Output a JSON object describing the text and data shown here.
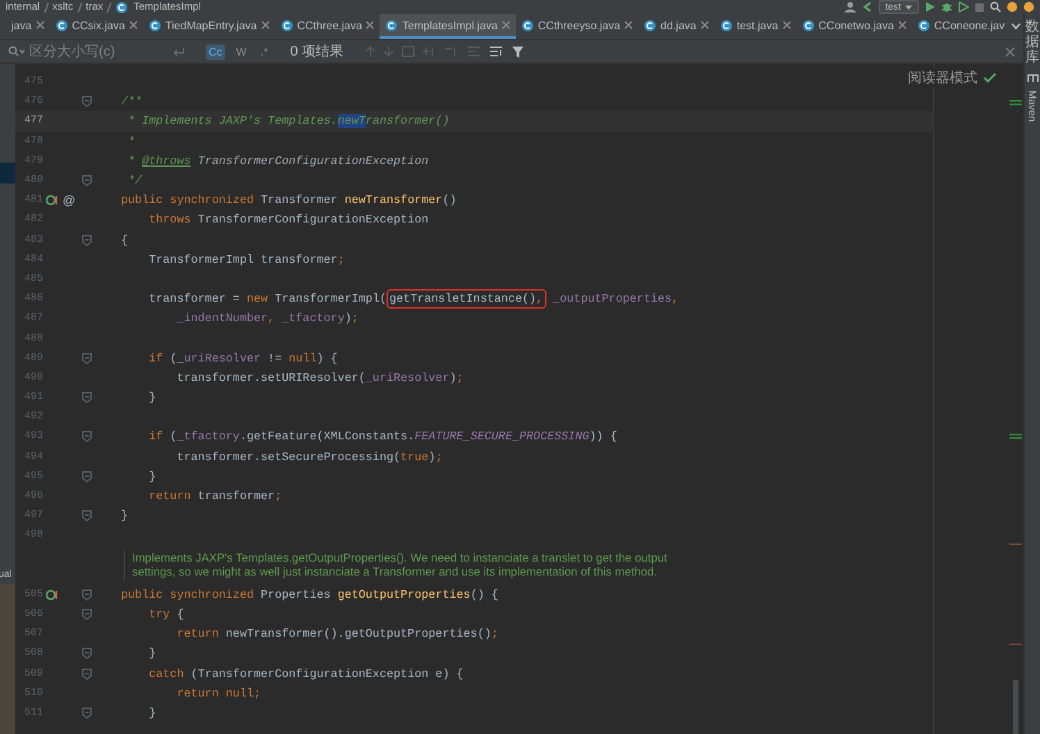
{
  "toolbar": {
    "breadcrumb": [
      "internal",
      "xsltc",
      "trax",
      "TemplatesImpl"
    ],
    "run_config": "test"
  },
  "tabs": [
    {
      "label": "java",
      "kind": "plain",
      "selected": false,
      "closable": true
    },
    {
      "label": "CCsix.java",
      "kind": "class",
      "selected": false,
      "closable": true
    },
    {
      "label": "TiedMapEntry.java",
      "kind": "class",
      "selected": false,
      "closable": true
    },
    {
      "label": "CCthree.java",
      "kind": "class",
      "selected": false,
      "closable": true
    },
    {
      "label": "TemplatesImpl.java",
      "kind": "class",
      "selected": true,
      "closable": true
    },
    {
      "label": "CCthreeyso.java",
      "kind": "class",
      "selected": false,
      "closable": true
    },
    {
      "label": "dd.java",
      "kind": "class",
      "selected": false,
      "closable": true
    },
    {
      "label": "test.java",
      "kind": "class",
      "selected": false,
      "closable": true
    },
    {
      "label": "CConetwo.java",
      "kind": "class",
      "selected": false,
      "closable": true
    },
    {
      "label": "CConeone.jav",
      "kind": "class",
      "selected": false,
      "closable": false
    }
  ],
  "search": {
    "placeholder": "区分大小写(c)",
    "toggles": [
      {
        "label": "Cc",
        "selected": true
      },
      {
        "label": "W",
        "selected": false
      },
      {
        "label": ".*",
        "selected": false
      }
    ],
    "result": "0 项结果"
  },
  "left_panel": {
    "text": "ual"
  },
  "reader_mode": "阅读器模式",
  "sidebar": {
    "items": [
      {
        "label": "数据库",
        "kind": "cjk"
      },
      {
        "label": "Maven",
        "kind": "latin"
      }
    ]
  },
  "lines": [
    {
      "kind": "code",
      "number": "475",
      "current": false,
      "fold": false
    },
    {
      "kind": "code",
      "number": "476",
      "current": false,
      "fold": true,
      "tokens": [
        {
          "kind": "doc",
          "text": "/**"
        }
      ]
    },
    {
      "kind": "code",
      "number": "477",
      "current": true,
      "fold": false,
      "tokens": [
        {
          "kind": "doc",
          "text": " * Implements JAXP's Templates."
        },
        {
          "kind": "match",
          "text": "newT"
        },
        {
          "kind": "doc",
          "text": "ransformer()"
        }
      ]
    },
    {
      "kind": "code",
      "number": "478",
      "current": false,
      "fold": false,
      "tokens": [
        {
          "kind": "doc",
          "text": " *"
        }
      ]
    },
    {
      "kind": "code",
      "number": "479",
      "current": false,
      "fold": false,
      "tokens": [
        {
          "kind": "doc",
          "text": " * "
        },
        {
          "kind": "doctag",
          "text": "@throws"
        },
        {
          "kind": "docref",
          "text": " TransformerConfigurationException"
        }
      ]
    },
    {
      "kind": "code",
      "number": "480",
      "current": false,
      "fold": true,
      "tokens": [
        {
          "kind": "doc",
          "text": " */"
        }
      ]
    },
    {
      "kind": "code",
      "number": "481",
      "current": false,
      "fold": false,
      "gutter": [
        {
          "kind": "implements"
        },
        {
          "kind": "label",
          "text": "@"
        }
      ],
      "tokens": [
        {
          "kind": "keyword",
          "text": "public synchronized "
        },
        {
          "kind": "plain",
          "text": "Transformer "
        },
        {
          "kind": "decl",
          "text": "newTransformer"
        },
        {
          "kind": "plain",
          "text": "()"
        }
      ]
    },
    {
      "kind": "code",
      "number": "482",
      "current": false,
      "fold": false,
      "tokens": [
        {
          "kind": "keyword",
          "text": "    throws "
        },
        {
          "kind": "plain",
          "text": "TransformerConfigurationException"
        }
      ]
    },
    {
      "kind": "code",
      "number": "483",
      "current": false,
      "fold": true,
      "tokens": [
        {
          "kind": "plain",
          "text": "{"
        }
      ]
    },
    {
      "kind": "code",
      "number": "484",
      "current": false,
      "fold": false,
      "tokens": [
        {
          "kind": "plain",
          "text": "    TransformerImpl transformer"
        },
        {
          "kind": "keyword",
          "text": ";"
        }
      ]
    },
    {
      "kind": "code",
      "number": "485",
      "current": false,
      "fold": false
    },
    {
      "kind": "code",
      "number": "486",
      "current": false,
      "fold": false,
      "tokens": [
        {
          "kind": "plain",
          "text": "    transformer = "
        },
        {
          "kind": "keyword",
          "text": "new "
        },
        {
          "kind": "plain",
          "text": "TransformerImpl("
        },
        {
          "kind": "plain",
          "text": "getTransletInstance()",
          "boxed": true
        },
        {
          "kind": "keyword",
          "text": ",",
          "boxed": true
        },
        {
          "kind": "field",
          "text": " _outputProperties"
        },
        {
          "kind": "keyword",
          "text": ","
        }
      ]
    },
    {
      "kind": "code",
      "number": "487",
      "current": false,
      "fold": false,
      "tokens": [
        {
          "kind": "field",
          "text": "        _indentNumber"
        },
        {
          "kind": "keyword",
          "text": ", "
        },
        {
          "kind": "field",
          "text": "_tfactory"
        },
        {
          "kind": "plain",
          "text": ")"
        },
        {
          "kind": "keyword",
          "text": ";"
        }
      ]
    },
    {
      "kind": "code",
      "number": "488",
      "current": false,
      "fold": false
    },
    {
      "kind": "code",
      "number": "489",
      "current": false,
      "fold": true,
      "tokens": [
        {
          "kind": "keyword",
          "text": "    if "
        },
        {
          "kind": "plain",
          "text": "("
        },
        {
          "kind": "field",
          "text": "_uriResolver"
        },
        {
          "kind": "plain",
          "text": " != "
        },
        {
          "kind": "keyword",
          "text": "null"
        },
        {
          "kind": "plain",
          "text": ") {"
        }
      ]
    },
    {
      "kind": "code",
      "number": "490",
      "current": false,
      "fold": false,
      "tokens": [
        {
          "kind": "plain",
          "text": "        transformer.setURIResolver("
        },
        {
          "kind": "field",
          "text": "_uriResolver"
        },
        {
          "kind": "plain",
          "text": ")"
        },
        {
          "kind": "keyword",
          "text": ";"
        }
      ]
    },
    {
      "kind": "code",
      "number": "491",
      "current": false,
      "fold": true,
      "tokens": [
        {
          "kind": "plain",
          "text": "    }"
        }
      ]
    },
    {
      "kind": "code",
      "number": "492",
      "current": false,
      "fold": false
    },
    {
      "kind": "code",
      "number": "493",
      "current": false,
      "fold": true,
      "tokens": [
        {
          "kind": "keyword",
          "text": "    if "
        },
        {
          "kind": "plain",
          "text": "("
        },
        {
          "kind": "field",
          "text": "_tfactory"
        },
        {
          "kind": "plain",
          "text": ".getFeature(XMLConstants."
        },
        {
          "kind": "constant",
          "text": "FEATURE_SECURE_PROCESSING"
        },
        {
          "kind": "plain",
          "text": ")) {"
        }
      ]
    },
    {
      "kind": "code",
      "number": "494",
      "current": false,
      "fold": false,
      "tokens": [
        {
          "kind": "plain",
          "text": "        transformer.setSecureProcessing("
        },
        {
          "kind": "keyword",
          "text": "true"
        },
        {
          "kind": "plain",
          "text": ")"
        },
        {
          "kind": "keyword",
          "text": ";"
        }
      ]
    },
    {
      "kind": "code",
      "number": "495",
      "current": false,
      "fold": true,
      "tokens": [
        {
          "kind": "plain",
          "text": "    }"
        }
      ]
    },
    {
      "kind": "code",
      "number": "496",
      "current": false,
      "fold": false,
      "tokens": [
        {
          "kind": "keyword",
          "text": "    return "
        },
        {
          "kind": "plain",
          "text": "transformer"
        },
        {
          "kind": "keyword",
          "text": ";"
        }
      ]
    },
    {
      "kind": "code",
      "number": "497",
      "current": false,
      "fold": true,
      "tokens": [
        {
          "kind": "plain",
          "text": "}"
        }
      ]
    },
    {
      "kind": "code",
      "number": "498",
      "current": false,
      "fold": false
    },
    {
      "kind": "doc",
      "text": "Implements JAXP's Templates.getOutputProperties(). We need to instanciate a translet to get the output settings, so we might as well just instanciate a Transformer and use its implementation of this method."
    },
    {
      "kind": "code",
      "number": "505",
      "current": false,
      "fold": true,
      "gutter": [
        {
          "kind": "implements"
        }
      ],
      "tokens": [
        {
          "kind": "keyword",
          "text": "public synchronized "
        },
        {
          "kind": "plain",
          "text": "Properties "
        },
        {
          "kind": "decl",
          "text": "getOutputProperties"
        },
        {
          "kind": "plain",
          "text": "() {"
        }
      ]
    },
    {
      "kind": "code",
      "number": "506",
      "current": false,
      "fold": true,
      "tokens": [
        {
          "kind": "keyword",
          "text": "    try "
        },
        {
          "kind": "plain",
          "text": "{"
        }
      ]
    },
    {
      "kind": "code",
      "number": "507",
      "current": false,
      "fold": false,
      "tokens": [
        {
          "kind": "keyword",
          "text": "        return "
        },
        {
          "kind": "plain",
          "text": "newTransformer().getOutputProperties()"
        },
        {
          "kind": "keyword",
          "text": ";"
        }
      ]
    },
    {
      "kind": "code",
      "number": "508",
      "current": false,
      "fold": true,
      "tokens": [
        {
          "kind": "plain",
          "text": "    }"
        }
      ]
    },
    {
      "kind": "code",
      "number": "509",
      "current": false,
      "fold": true,
      "tokens": [
        {
          "kind": "keyword",
          "text": "    catch "
        },
        {
          "kind": "plain",
          "text": "(TransformerConfigurationException e) {"
        }
      ]
    },
    {
      "kind": "code",
      "number": "510",
      "current": false,
      "fold": false,
      "tokens": [
        {
          "kind": "keyword",
          "text": "        return null;"
        }
      ]
    },
    {
      "kind": "code",
      "number": "511",
      "current": false,
      "fold": true,
      "tokens": [
        {
          "kind": "plain",
          "text": "    }"
        }
      ]
    }
  ]
}
